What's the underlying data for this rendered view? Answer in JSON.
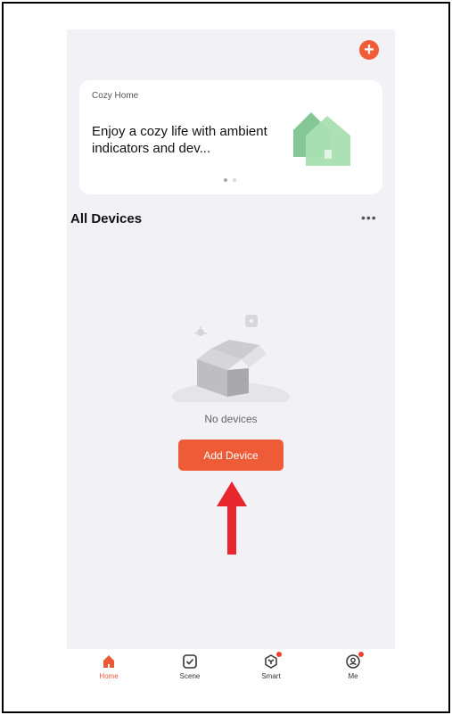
{
  "header": {
    "add_icon": "plus-circle-icon",
    "accent_color": "#ee5b37"
  },
  "banner": {
    "subtitle": "Cozy Home",
    "title": "Enjoy a cozy life with ambient indicators and dev...",
    "illustration_icon": "green-house-illustration",
    "pagination": {
      "total": 2,
      "active": 1
    }
  },
  "devices_section": {
    "title": "All Devices",
    "more_label": "•••"
  },
  "empty_state": {
    "icon": "open-box-illustration",
    "message": "No devices",
    "button_label": "Add Device"
  },
  "annotation": {
    "type": "red-arrow",
    "color": "#e8262e"
  },
  "tabbar": {
    "tabs": [
      {
        "label": "Home",
        "icon": "home-icon",
        "active": true,
        "badge": false
      },
      {
        "label": "Scene",
        "icon": "checkbox-icon",
        "active": false,
        "badge": false
      },
      {
        "label": "Smart",
        "icon": "smart-cube-icon",
        "active": false,
        "badge": true
      },
      {
        "label": "Me",
        "icon": "profile-icon",
        "active": false,
        "badge": true
      }
    ]
  }
}
